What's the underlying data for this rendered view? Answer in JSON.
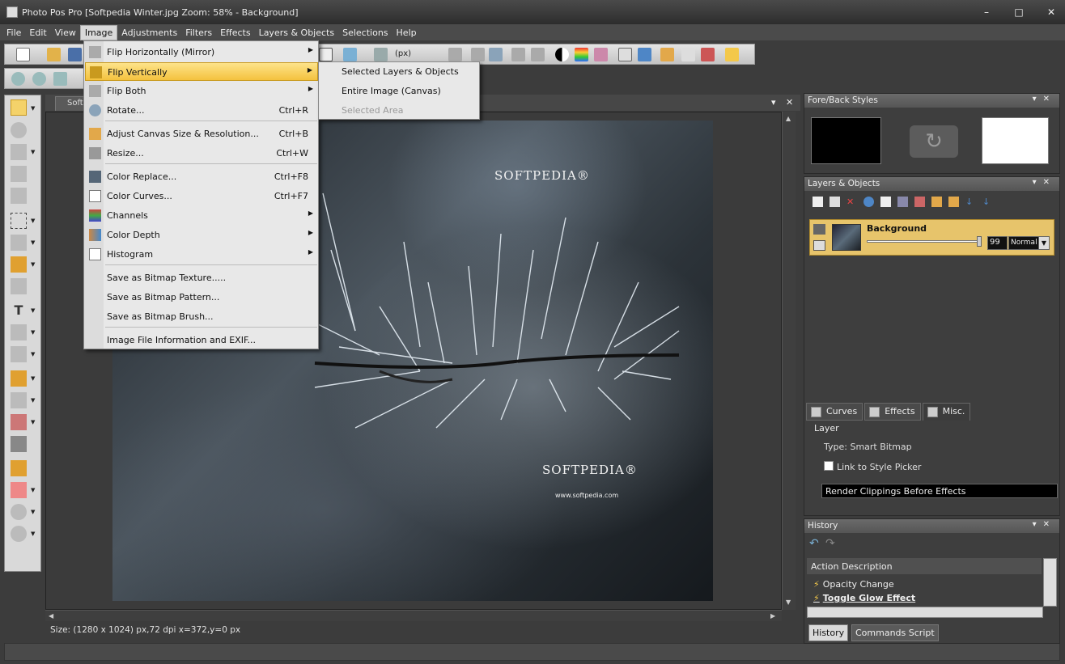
{
  "window": {
    "title": "Photo Pos Pro [Softpedia Winter.jpg Zoom: 58% - Background]",
    "controls": [
      "–",
      "□",
      "✕"
    ]
  },
  "menubar": {
    "items": [
      "File",
      "Edit",
      "View",
      "Image",
      "Adjustments",
      "Filters",
      "Effects",
      "Layers & Objects",
      "Selections",
      "Help"
    ],
    "active": "Image"
  },
  "toolbar": {
    "zoom_unit": "(px)"
  },
  "document": {
    "tab_label": "Soft",
    "watermark_top": "SOFTPEDIA®",
    "watermark_bottom": "SOFTPEDIA®",
    "watermark_url": "www.softpedia.com"
  },
  "status": {
    "text": "Size: (1280 x 1024) px,72 dpi   x=372,y=0 px"
  },
  "image_menu": {
    "items": [
      {
        "label": "Flip Horizontally (Mirror)",
        "shortcut": "",
        "icon": "flip-horizontal-icon",
        "submenu": true
      },
      {
        "label": "Flip Vertically",
        "shortcut": "",
        "icon": "flip-vertical-icon",
        "submenu": true,
        "highlighted": true
      },
      {
        "label": "Flip Both",
        "shortcut": "",
        "icon": "flip-both-icon",
        "submenu": true
      },
      {
        "label": "Rotate...",
        "shortcut": "Ctrl+R",
        "icon": "rotate-icon"
      },
      {
        "label": "Adjust Canvas Size & Resolution...",
        "shortcut": "Ctrl+B",
        "icon": "canvas-size-icon"
      },
      {
        "label": "Resize...",
        "shortcut": "Ctrl+W",
        "icon": "resize-icon"
      },
      {
        "label": "Color Replace...",
        "shortcut": "Ctrl+F8",
        "icon": "color-replace-icon"
      },
      {
        "label": "Color Curves...",
        "shortcut": "Ctrl+F7",
        "icon": "color-curves-icon"
      },
      {
        "label": "Channels",
        "shortcut": "",
        "icon": "channels-icon",
        "submenu": true
      },
      {
        "label": "Color Depth",
        "shortcut": "",
        "icon": "color-depth-icon",
        "submenu": true
      },
      {
        "label": "Histogram",
        "shortcut": "",
        "icon": "histogram-icon",
        "submenu": true
      },
      {
        "label": "Save as Bitmap Texture.....",
        "shortcut": ""
      },
      {
        "label": "Save as Bitmap Pattern...",
        "shortcut": ""
      },
      {
        "label": "Save as Bitmap Brush...",
        "shortcut": ""
      },
      {
        "label": "Image File Information and EXIF...",
        "shortcut": ""
      }
    ]
  },
  "flip_submenu": {
    "items": [
      {
        "label": "Selected Layers & Objects",
        "disabled": false
      },
      {
        "label": "Entire Image (Canvas)",
        "disabled": false
      },
      {
        "label": "Selected Area",
        "disabled": true
      }
    ]
  },
  "fore_back": {
    "title": "Fore/Back Styles",
    "fore_color": "#000000",
    "back_color": "#ffffff"
  },
  "layers": {
    "title": "Layers & Objects",
    "layer_name": "Background",
    "opacity": "99",
    "blend_mode": "Normal",
    "tabs": [
      "Curves",
      "Effects",
      "Misc."
    ],
    "active_tab": "Misc.",
    "group_label": "Layer",
    "type_label": "Type: Smart Bitmap",
    "link_label": "Link to Style Picker",
    "render_label": "Render Clippings Before Effects"
  },
  "history": {
    "title": "History",
    "column": "Action Description",
    "rows": [
      "Opacity Change",
      "Toggle Glow Effect"
    ],
    "tabs": [
      "History",
      "Commands Script"
    ]
  },
  "colors": {
    "accent": "#f4c23e",
    "panel_bg": "#3e3e3e"
  }
}
